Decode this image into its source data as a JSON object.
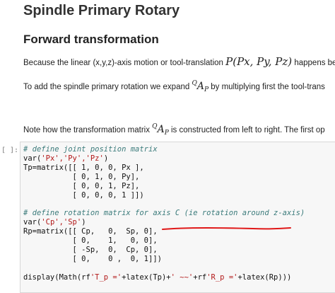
{
  "notebook": {
    "title": "Spindle Primary Rotary",
    "subtitle": "Forward transformation",
    "para1_text": "Because the linear (x,y,z)-axis motion or tool-translation ",
    "para1_math": "P(Px, Py, Pz)",
    "para1_tail": " happens betw",
    "para2_text": "To add the spindle primary rotation we expand ",
    "para2_math_sup": "Q",
    "para2_math": "A",
    "para2_math_sub": "P",
    "para2_tail": " by multiplying first the tool-trans",
    "para3_text": "Note how the transformation matrix ",
    "para3_math_sup": "Q",
    "para3_math": "A",
    "para3_math_sub": "P",
    "para3_tail": " is constructed from left to right. The first op",
    "cell_prompt": "[ ]:",
    "code": {
      "line1": "# define joint position matrix",
      "line2a": "var(",
      "line2b": "'Px','Py','Pz'",
      "line2c": ")",
      "line3": "Tp=matrix([[ 1, 0, 0, Px ],",
      "line4": "           [ 0, 1, 0, Py],",
      "line5": "           [ 0, 0, 1, Pz],",
      "line6": "           [ 0, 0, 0, 1 ]])",
      "line7": "",
      "line8": "# define rotation matrix for axis C (ie rotation around z-axis)",
      "line9a": "var(",
      "line9b": "'Cp','Sp'",
      "line9c": ")",
      "line10": "Rp=matrix([[ Cp,   0,  Sp, 0],",
      "line11": "           [ 0,    1,   0, 0],",
      "line12": "           [ -Sp,  0,  Cp, 0],",
      "line13": "           [ 0,    0 ,  0, 1]])",
      "line14": "",
      "line15a": "display(Math(rf",
      "line15b": "'T_p ='",
      "line15c": "+latex(Tp)+",
      "line15d": "' ~~'",
      "line15e": "+rf",
      "line15f": "'R_p ='",
      "line15g": "+latex(Rp)))"
    }
  }
}
